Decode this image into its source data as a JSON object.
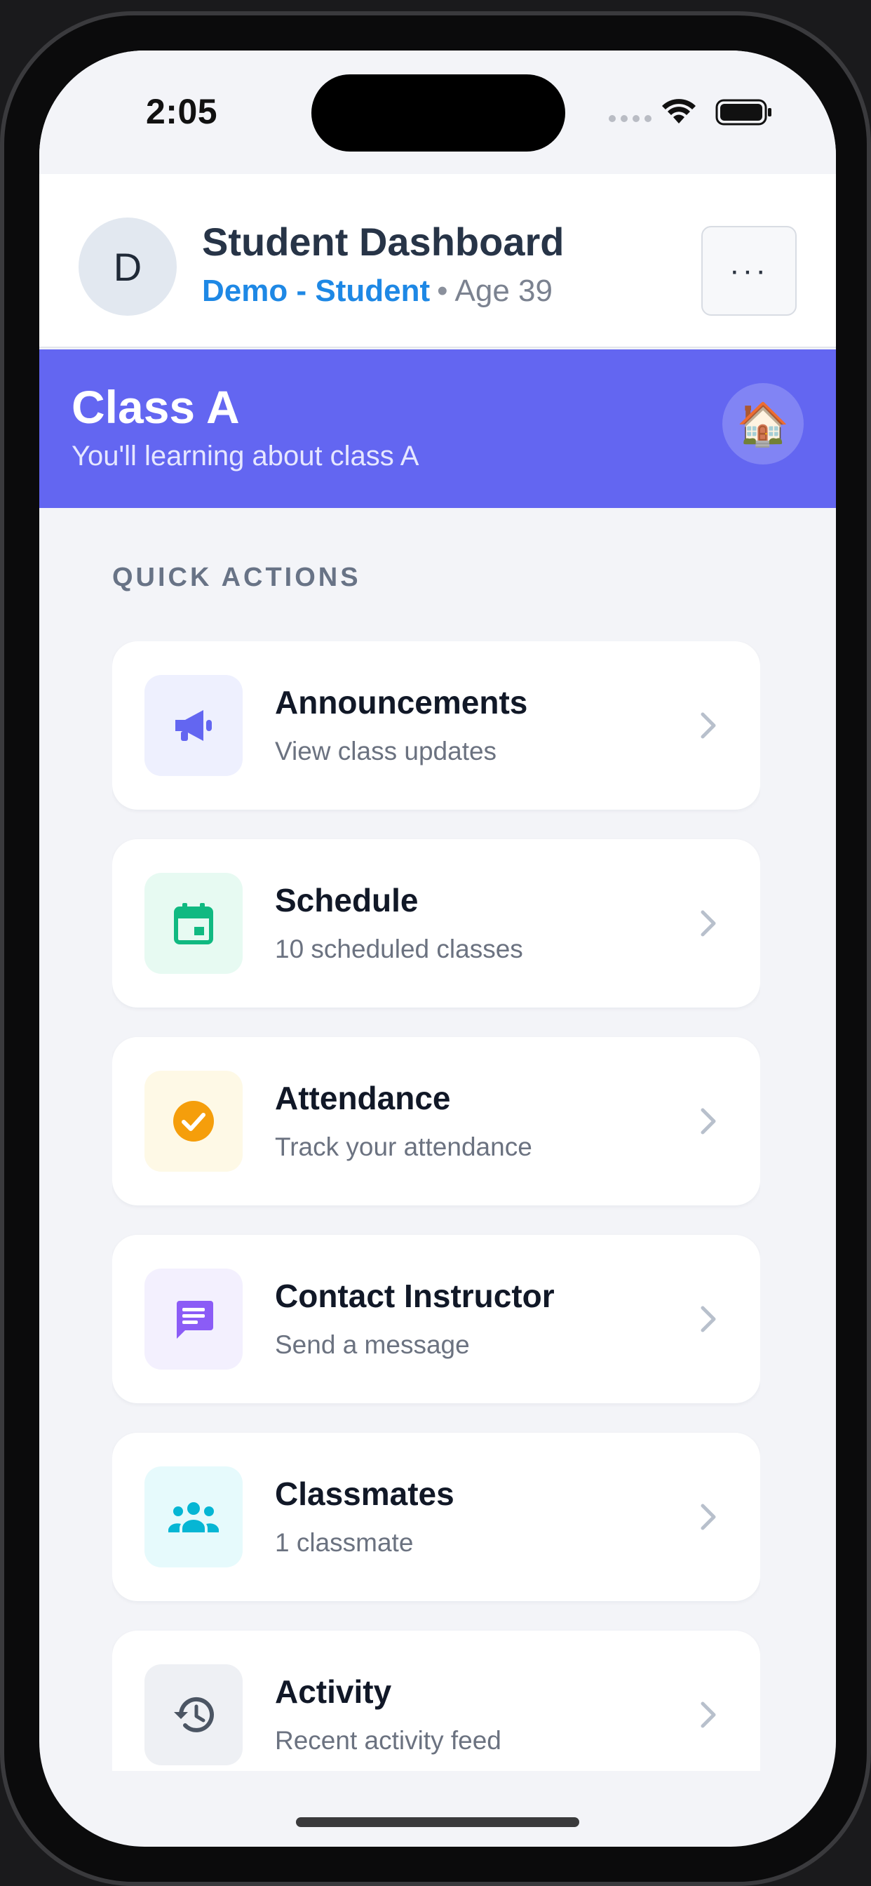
{
  "status_bar": {
    "time": "2:05"
  },
  "header": {
    "avatar_initial": "D",
    "title": "Student Dashboard",
    "user_name": "Demo - Student",
    "separator": "•",
    "age": "Age 39",
    "menu_label": "···"
  },
  "banner": {
    "title": "Class A",
    "subtitle": "You'll learning about class A",
    "icon": "🏠",
    "color": "#6366f1"
  },
  "quick_actions": {
    "label": "QUICK ACTIONS",
    "items": [
      {
        "title": "Announcements",
        "subtitle": "View class updates",
        "icon": "megaphone-icon",
        "icon_color": "#6366f1",
        "bg": "#eef0fe"
      },
      {
        "title": "Schedule",
        "subtitle": "10 scheduled classes",
        "icon": "calendar-icon",
        "icon_color": "#10b981",
        "bg": "#e7faf2"
      },
      {
        "title": "Attendance",
        "subtitle": "Track your attendance",
        "icon": "check-circle-icon",
        "icon_color": "#f59e0b",
        "bg": "#fef9e6"
      },
      {
        "title": "Contact Instructor",
        "subtitle": "Send a message",
        "icon": "message-icon",
        "icon_color": "#8b5cf6",
        "bg": "#f3f0fe"
      },
      {
        "title": "Classmates",
        "subtitle": "1 classmate",
        "icon": "people-icon",
        "icon_color": "#06b6d4",
        "bg": "#e6fafc"
      },
      {
        "title": "Activity",
        "subtitle": "Recent activity feed",
        "icon": "history-icon",
        "icon_color": "#4b5563",
        "bg": "#eef0f4"
      }
    ]
  }
}
